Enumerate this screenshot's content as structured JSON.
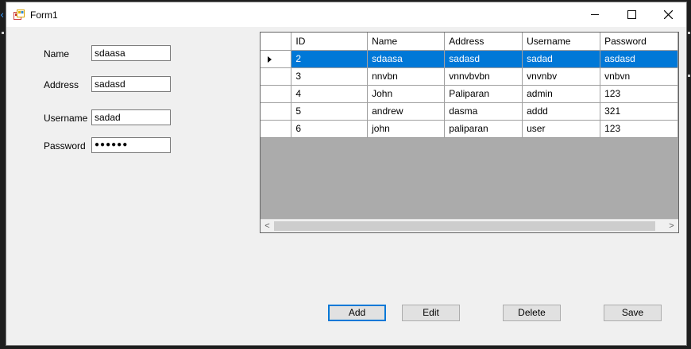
{
  "window": {
    "title": "Form1"
  },
  "form": {
    "fields": [
      {
        "label": "Name",
        "value": "sdaasa"
      },
      {
        "label": "Address",
        "value": "sadasd"
      },
      {
        "label": "Username",
        "value": "sadad"
      },
      {
        "label": "Password",
        "value": "●●●●●●"
      }
    ]
  },
  "grid": {
    "columns": [
      "ID",
      "Name",
      "Address",
      "Username",
      "Password"
    ],
    "rows": [
      {
        "cells": [
          "2",
          "sdaasa",
          "sadasd",
          "sadad",
          "asdasd"
        ],
        "selected": true
      },
      {
        "cells": [
          "3",
          "nnvbn",
          "vnnvbvbn",
          "vnvnbv",
          "vnbvn"
        ],
        "selected": false
      },
      {
        "cells": [
          "4",
          "John",
          "Paliparan",
          "admin",
          "123"
        ],
        "selected": false
      },
      {
        "cells": [
          "5",
          "andrew",
          "dasma",
          "addd",
          "321"
        ],
        "selected": false
      },
      {
        "cells": [
          "6",
          "john",
          "paliparan",
          "user",
          "123"
        ],
        "selected": false
      }
    ]
  },
  "buttons": {
    "add": "Add",
    "edit": "Edit",
    "delete": "Delete",
    "save": "Save"
  },
  "colors": {
    "selection": "#0078d7",
    "grid_background": "#ababab",
    "form_background": "#f0f0f0"
  }
}
